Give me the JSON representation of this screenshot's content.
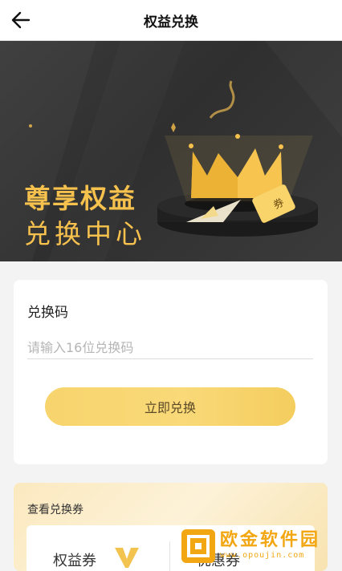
{
  "header": {
    "title": "权益兑换"
  },
  "banner": {
    "line1": "尊享权益",
    "line2": "兑换中心",
    "ticket_glyph": "券"
  },
  "redeem": {
    "label": "兑换码",
    "input_placeholder": "请输入16位兑换码",
    "input_value": "",
    "button_label": "立即兑换"
  },
  "coupons": {
    "label": "查看兑换券",
    "items": [
      {
        "label": "权益券"
      },
      {
        "label": "优惠券"
      }
    ]
  },
  "watermark": {
    "title": "欧金软件园",
    "url": "www.opoujin.com"
  },
  "colors": {
    "gold": "#f6c14d",
    "button_gold": "#f7d46d",
    "banner_dark": "#333333",
    "watermark_orange": "#f2a712"
  }
}
